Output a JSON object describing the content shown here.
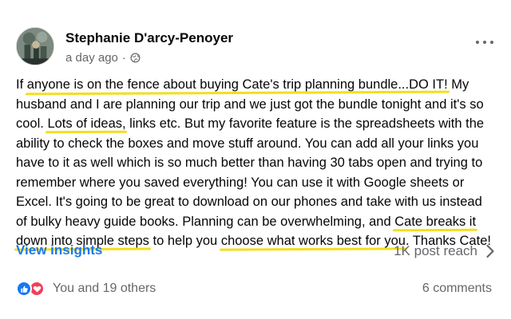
{
  "post": {
    "author": "Stephanie D'arcy-Penoyer",
    "timestamp": "a day ago",
    "separator": "·",
    "audience_icon": "globe-icon",
    "more_icon": "more-options-icon",
    "body_lines": [
      [
        "If ",
        "anyone is on the fence about buying Cate's trip planning bundle...DO IT!",
        " My"
      ],
      [
        "husband and I are planning our trip and we just got the bundle tonight and it's so"
      ],
      [
        "cool. ",
        "Lots of ideas,",
        " links etc. But my favorite feature is the spreadsheets with the"
      ],
      [
        "ability to check the boxes and move stuff around. You can add all your links you"
      ],
      [
        "have to it as well which is so much better than having 30 tabs open and trying to"
      ],
      [
        "remember where you saved everything!  You can use it with Google sheets or"
      ],
      [
        "Excel. It's going to be great to download on our phones and take with us instead"
      ],
      [
        "of bulky heavy guide books. Planning can be overwhelming, and ",
        "Cate breaks it"
      ],
      [
        "down into simple steps",
        " to help you ",
        "choose what works best for you",
        ". Thanks Cate!"
      ]
    ],
    "highlight_color": "#f2df1e"
  },
  "insights": {
    "link_label": "View insights",
    "reach_label": "1K post reach",
    "chevron_icon": "chevron-right-icon"
  },
  "engagement": {
    "reaction_icons": [
      "like-reaction-icon",
      "love-reaction-icon"
    ],
    "reactions_label": "You and 19 others",
    "comments_label": "6 comments"
  },
  "colors": {
    "link_blue": "#1877f2",
    "secondary_text": "#65676b",
    "like_blue": "#1877f2",
    "love_red": "#f33e58"
  }
}
